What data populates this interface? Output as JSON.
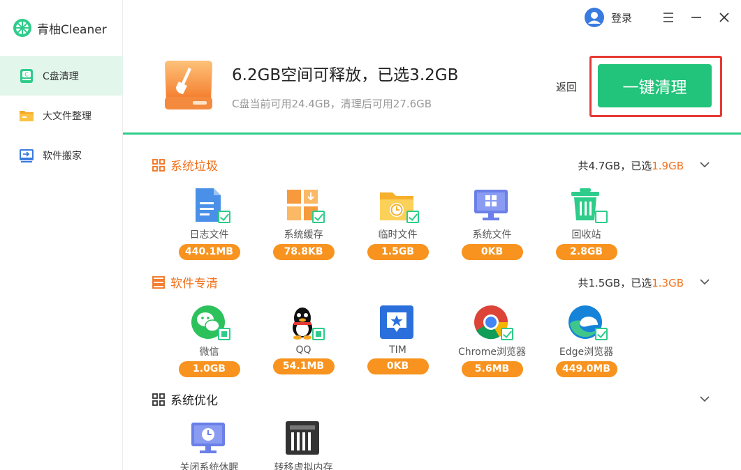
{
  "app": {
    "name": "青柚Cleaner"
  },
  "sidebar": {
    "items": [
      {
        "label": "C盘清理",
        "active": true
      },
      {
        "label": "大文件整理"
      },
      {
        "label": "软件搬家"
      }
    ]
  },
  "topbar": {
    "login_label": "登录"
  },
  "header": {
    "headline": "6.2GB空间可释放，已选3.2GB",
    "subline": "C盘当前可用24.4GB，清理后可用27.6GB",
    "back_label": "返回",
    "clean_label": "一键清理"
  },
  "sections": {
    "junk": {
      "title": "系统垃圾",
      "summary_prefix": "共4.7GB，已选",
      "summary_selected": "1.9GB",
      "items": [
        {
          "label": "日志文件",
          "size": "440.1MB"
        },
        {
          "label": "系统缓存",
          "size": "78.8KB"
        },
        {
          "label": "临时文件",
          "size": "1.5GB"
        },
        {
          "label": "系统文件",
          "size": "0KB"
        },
        {
          "label": "回收站",
          "size": "2.8GB"
        }
      ]
    },
    "software": {
      "title": "软件专清",
      "summary_prefix": "共1.5GB，已选",
      "summary_selected": "1.3GB",
      "items": [
        {
          "label": "微信",
          "size": "1.0GB"
        },
        {
          "label": "QQ",
          "size": "54.1MB"
        },
        {
          "label": "TIM",
          "size": "0KB"
        },
        {
          "label": "Chrome浏览器",
          "size": "5.6MB"
        },
        {
          "label": "Edge浏览器",
          "size": "449.0MB"
        }
      ]
    },
    "optimize": {
      "title": "系统优化",
      "items": [
        {
          "label": "关闭系统休眠"
        },
        {
          "label": "转移虚拟内存"
        }
      ]
    }
  },
  "colors": {
    "accent": "#22c37a",
    "orange": "#f7931e",
    "highlight": "#f2711c",
    "alert": "#e53935"
  }
}
